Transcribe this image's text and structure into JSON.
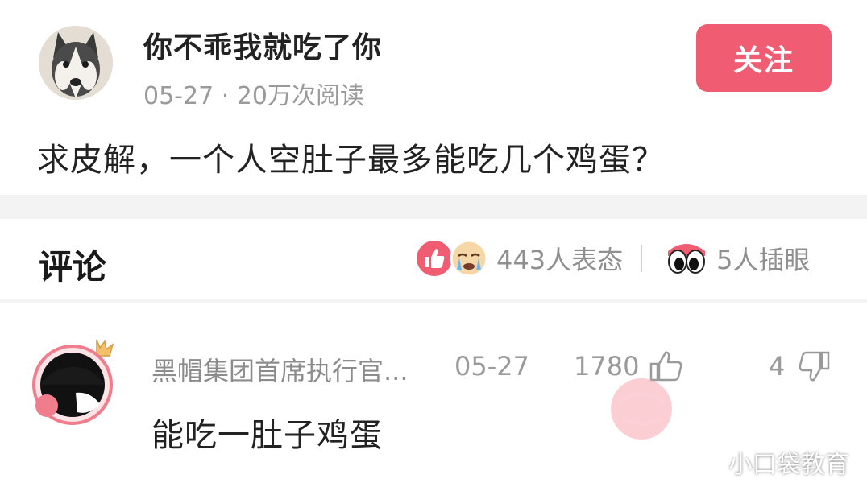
{
  "post": {
    "author": "你不乖我就吃了你",
    "date": "05-27",
    "meta_sep": " · ",
    "views": "20万次阅读",
    "follow_label": "关注",
    "text": "求皮解，一个人空肚子最多能吃几个鸡蛋？"
  },
  "comments_header": {
    "title": "评论",
    "reaction_count": "443人表态",
    "eye_count": "5人插眼"
  },
  "comments": [
    {
      "user": "黑帽集团首席执行官...",
      "date": "05-27",
      "likes": "1780",
      "dislikes": "4",
      "text": "能吃一肚子鸡蛋"
    }
  ],
  "watermark": "小口袋教育",
  "colors": {
    "accent": "#f05d72",
    "muted_text": "#9a9a9a",
    "background": "#f3f3f3"
  },
  "icons": {
    "reaction_1": "thumbs-up-circle-icon",
    "reaction_2": "crying-face-icon",
    "eye": "big-eyes-icon",
    "like": "thumbs-up-outline-icon",
    "dislike": "thumbs-down-outline-icon"
  }
}
